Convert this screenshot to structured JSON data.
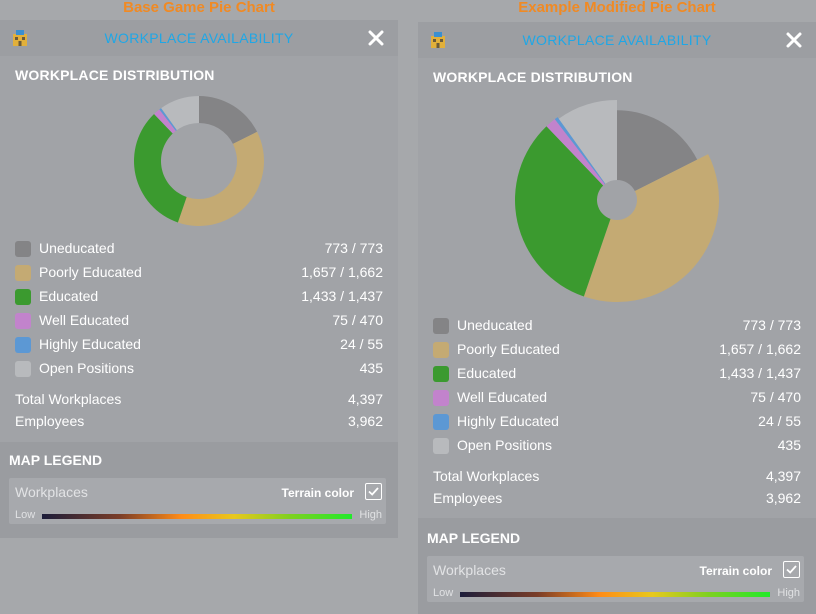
{
  "captions": {
    "left": "Base Game Pie Chart",
    "right": "Example Modified Pie Chart"
  },
  "window": {
    "title": "WORKPLACE AVAILABILITY",
    "icon": "building-icon",
    "close_icon": "close-icon"
  },
  "distribution": {
    "title": "WORKPLACE DISTRIBUTION",
    "rows": [
      {
        "label": "Uneducated",
        "value": "773 / 773",
        "color": "#848486"
      },
      {
        "label": "Poorly Educated",
        "value": "1,657 / 1,662",
        "color": "#c4aa73"
      },
      {
        "label": "Educated",
        "value": "1,433 / 1,437",
        "color": "#3b9a2f"
      },
      {
        "label": "Well Educated",
        "value": "75 / 470",
        "color": "#c283cc"
      },
      {
        "label": "Highly Educated",
        "value": "24 / 55",
        "color": "#5c98d4"
      },
      {
        "label": "Open Positions",
        "value": "435",
        "color": "#b8babd"
      }
    ],
    "total_label": "Total Workplaces",
    "total_value": "4,397",
    "employees_label": "Employees",
    "employees_value": "3,962"
  },
  "chart_data": {
    "type": "pie",
    "categories": [
      "Uneducated",
      "Poorly Educated",
      "Educated",
      "Well Educated",
      "Highly Educated",
      "Open Positions"
    ],
    "values": [
      773,
      1657,
      1433,
      75,
      24,
      435
    ],
    "colors": [
      "#848486",
      "#c4aa73",
      "#3b9a2f",
      "#c283cc",
      "#5c98d4",
      "#b8babd"
    ]
  },
  "legend": {
    "title": "MAP LEGEND",
    "workplaces_label": "Workplaces",
    "terrain_label": "Terrain color",
    "terrain_checked": true,
    "low_label": "Low",
    "high_label": "High"
  }
}
